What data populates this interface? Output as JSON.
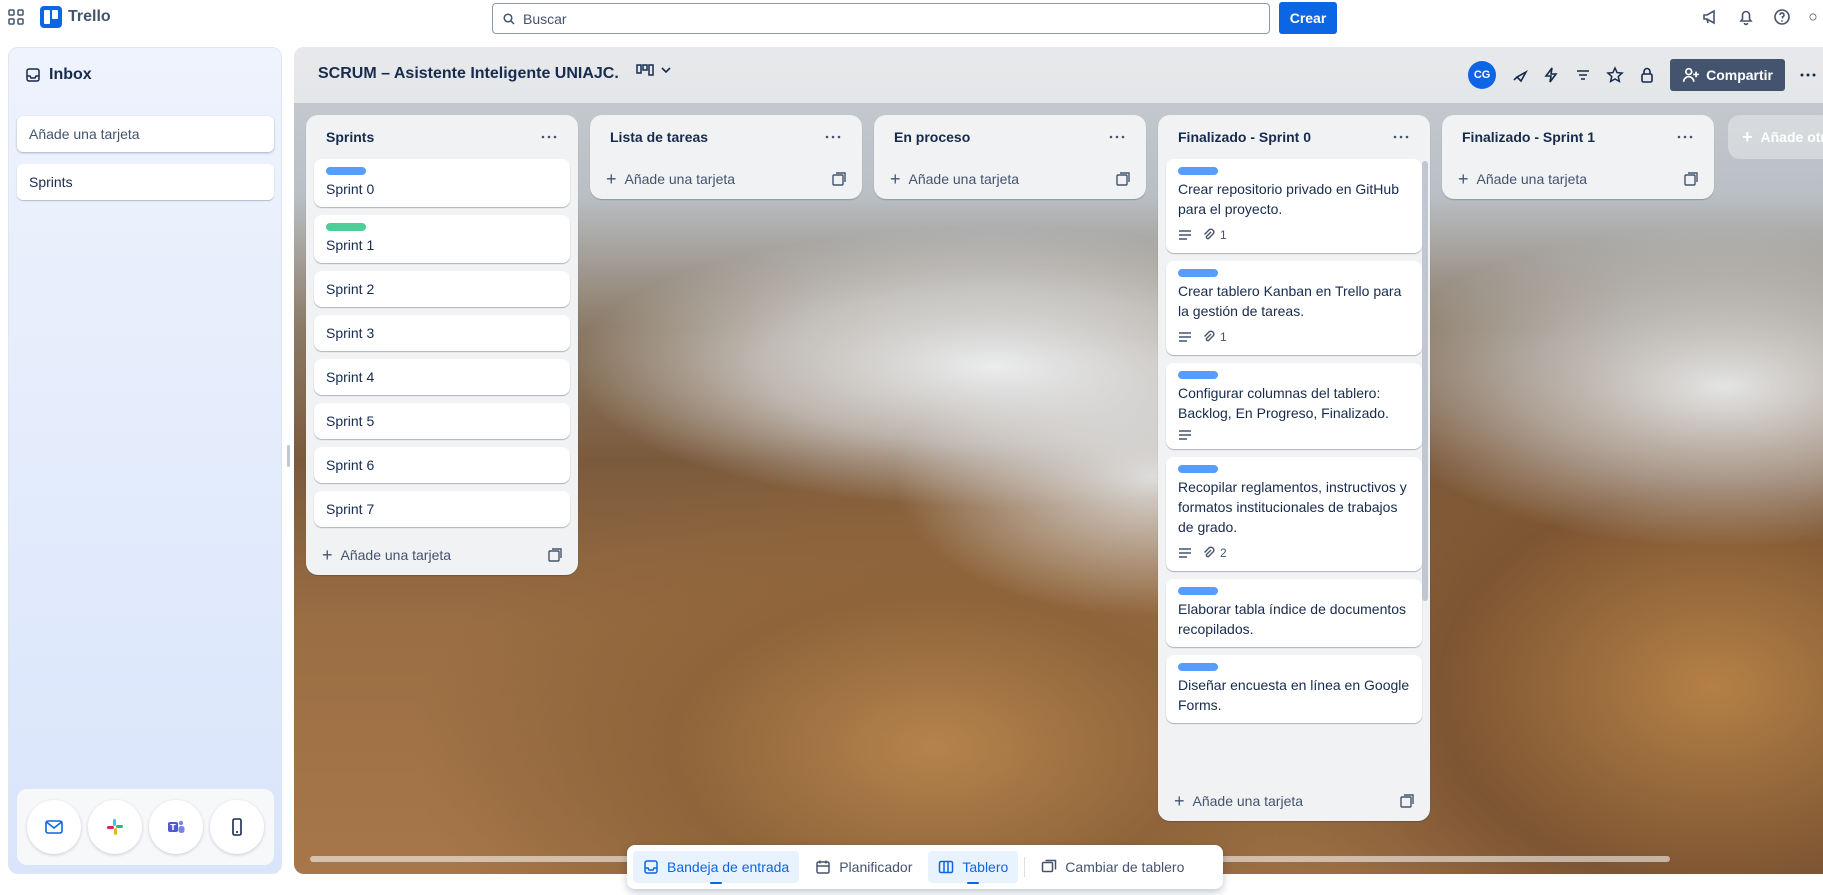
{
  "topbar": {
    "app_name": "Trello",
    "search_placeholder": "Buscar",
    "create_label": "Crear"
  },
  "inbox": {
    "title": "Inbox",
    "add_card_placeholder": "Añade una tarjeta",
    "cards": [
      {
        "title": "Sprints"
      }
    ],
    "footer_apps": [
      "mail-icon",
      "slack-icon",
      "teams-icon",
      "mobile-icon"
    ]
  },
  "board": {
    "title": "SCRUM – Asistente Inteligente UNIAJC.",
    "avatar_initials": "CG",
    "share_label": "Compartir",
    "add_list_label": "Añade otra lista"
  },
  "lists": [
    {
      "title": "Sprints",
      "cards": [
        {
          "title": "Sprint 0",
          "label_color": "#579dff"
        },
        {
          "title": "Sprint 1",
          "label_color": "#4bce97"
        },
        {
          "title": "Sprint 2"
        },
        {
          "title": "Sprint 3"
        },
        {
          "title": "Sprint 4"
        },
        {
          "title": "Sprint 5"
        },
        {
          "title": "Sprint 6"
        },
        {
          "title": "Sprint 7"
        }
      ],
      "add_label": "Añade una tarjeta"
    },
    {
      "title": "Lista de tareas",
      "cards": [],
      "add_label": "Añade una tarjeta"
    },
    {
      "title": "En proceso",
      "cards": [],
      "add_label": "Añade una tarjeta"
    },
    {
      "title": "Finalizado - Sprint 0",
      "cards": [
        {
          "title": "Crear repositorio privado en GitHub para el proyecto.",
          "label_color": "#579dff",
          "description": true,
          "attachments": "1"
        },
        {
          "title": "Crear tablero Kanban en Trello para la gestión de tareas.",
          "label_color": "#579dff",
          "description": true,
          "attachments": "1"
        },
        {
          "title": "Configurar columnas del tablero: Backlog, En Progreso, Finalizado.",
          "label_color": "#579dff",
          "description": true
        },
        {
          "title": "Recopilar reglamentos, instructivos y formatos institucionales de trabajos de grado.",
          "label_color": "#579dff",
          "description": true,
          "attachments": "2"
        },
        {
          "title": "Elaborar tabla índice de documentos recopilados.",
          "label_color": "#579dff"
        },
        {
          "title": "Diseñar encuesta en línea en Google Forms.",
          "label_color": "#579dff"
        }
      ],
      "add_label": "Añade una tarjeta"
    },
    {
      "title": "Finalizado - Sprint 1",
      "cards": [],
      "add_label": "Añade una tarjeta"
    }
  ],
  "bottom_nav": {
    "inbox": "Bandeja de entrada",
    "planner": "Planificador",
    "board": "Tablero",
    "switch": "Cambiar de tablero"
  },
  "colors": {
    "accent": "#0c66e4",
    "label_blue": "#579dff",
    "label_green": "#4bce97"
  }
}
